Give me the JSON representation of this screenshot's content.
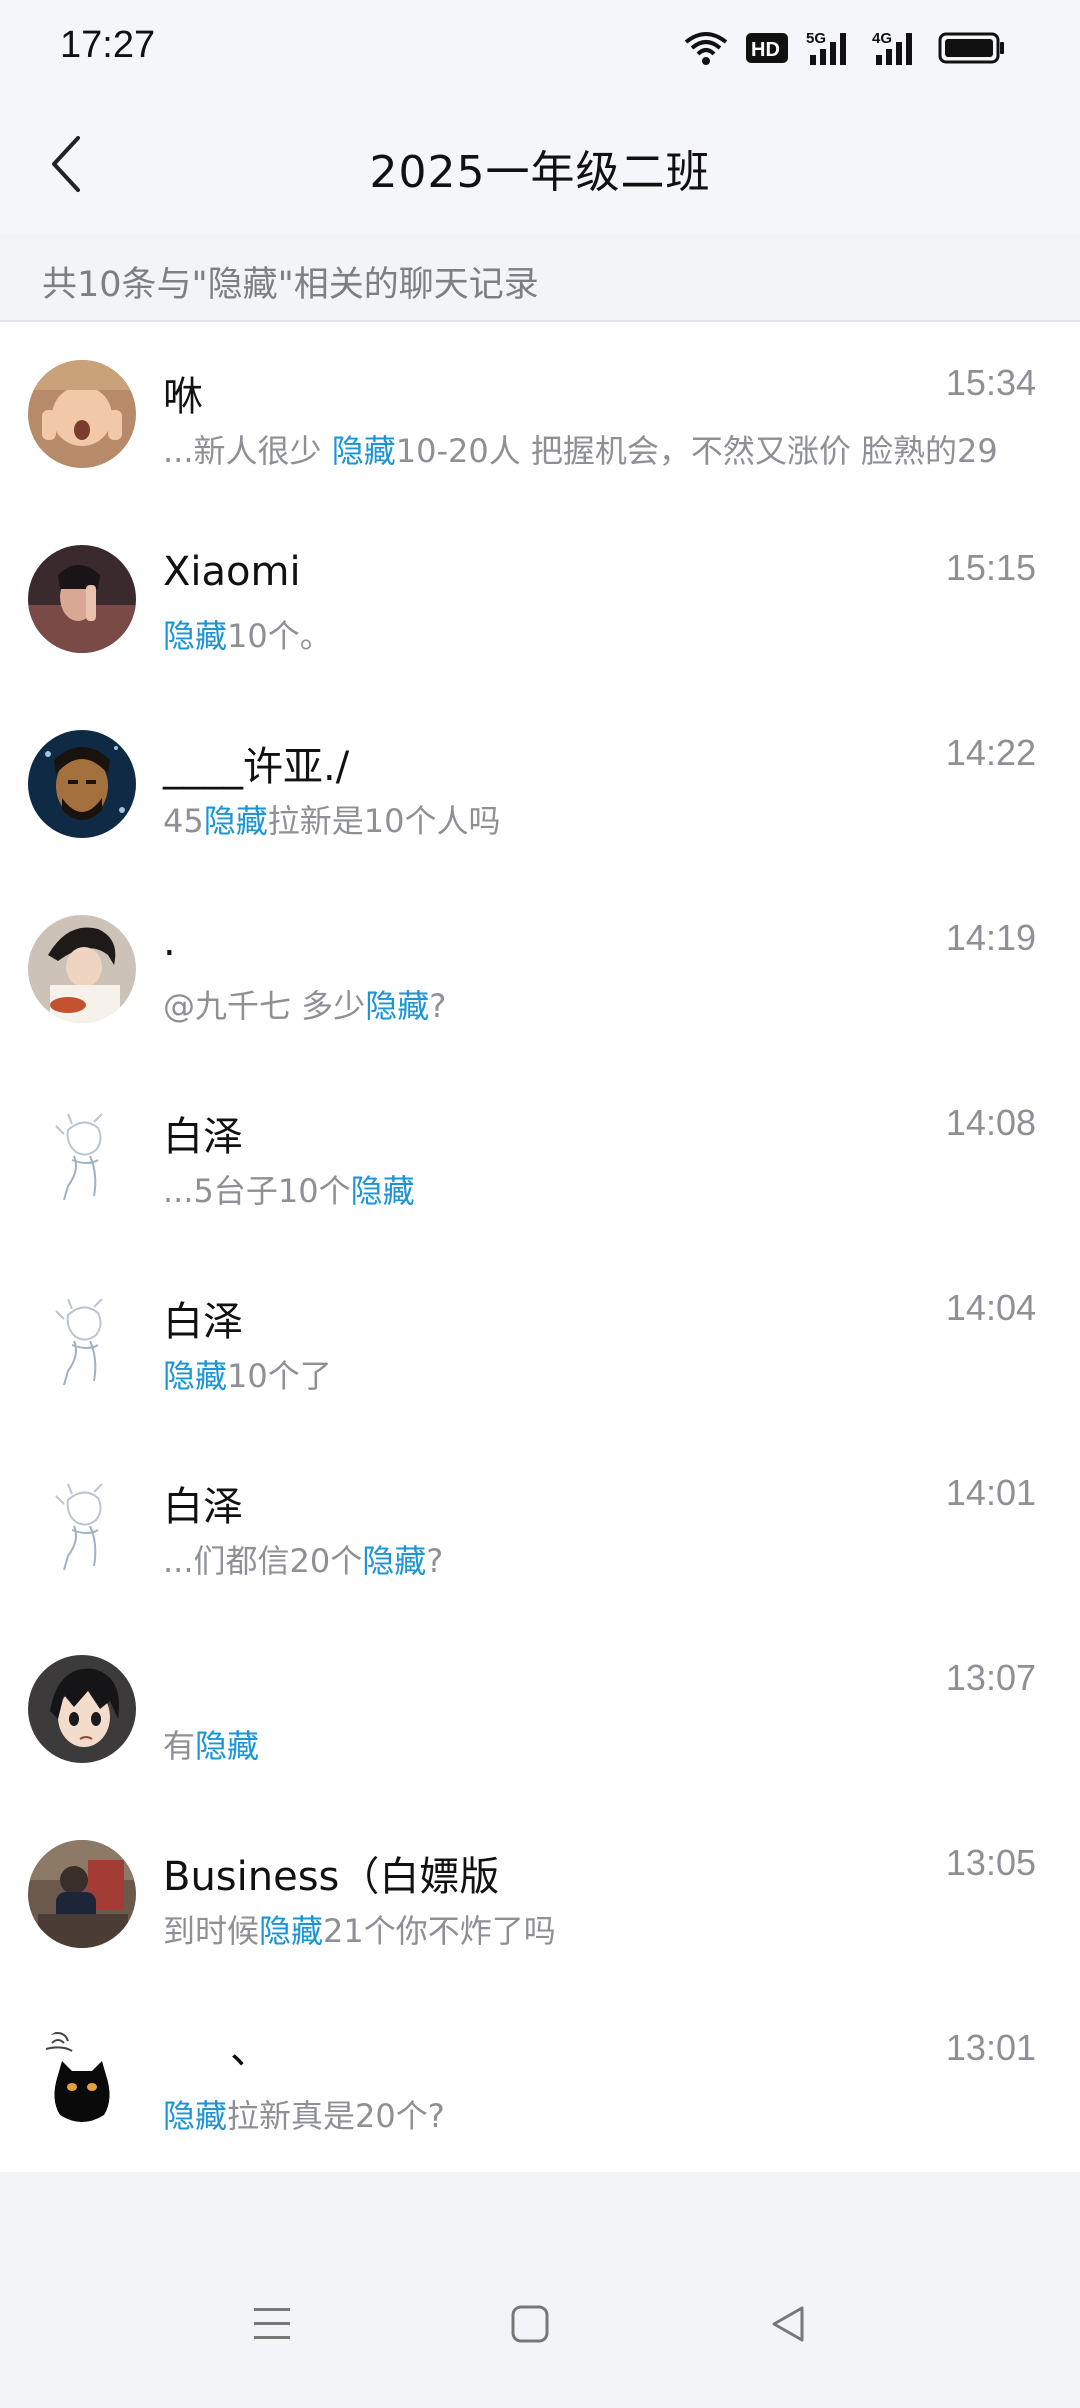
{
  "status": {
    "time": "17:27",
    "icons": [
      "wifi-icon",
      "hd-icon",
      "5g-signal-icon",
      "4g-signal-icon",
      "battery-icon"
    ],
    "hd_label": "HD",
    "net_5g": "5G",
    "net_4g": "4G"
  },
  "header": {
    "title": "2025一年级二班",
    "back_icon": "chevron-left-icon"
  },
  "summary": "共10条与\"隐藏\"相关的聊天记录",
  "colors": {
    "highlight": "#1b95d6",
    "muted": "#8e9096",
    "background": "#f3f4f8"
  },
  "results": [
    {
      "name": "咻",
      "time": "15:34",
      "pre": "...新人很少  ",
      "hl": "隐藏",
      "post": "10-20人   把握机会，不然又涨价  脸熟的29"
    },
    {
      "name": "Xiaomi",
      "time": "15:15",
      "pre": "",
      "hl": "隐藏",
      "post": "10个。"
    },
    {
      "name": "____许亚./",
      "time": "14:22",
      "pre": "45",
      "hl": "隐藏",
      "post": "拉新是10个人吗"
    },
    {
      "name": ".",
      "time": "14:19",
      "pre": "@九千七 多少",
      "hl": "隐藏",
      "post": "?"
    },
    {
      "name": "白泽",
      "time": "14:08",
      "pre": "...5台子10个",
      "hl": "隐藏",
      "post": ""
    },
    {
      "name": "白泽",
      "time": "14:04",
      "pre": "",
      "hl": "隐藏",
      "post": "10个了"
    },
    {
      "name": "白泽",
      "time": "14:01",
      "pre": "...们都信20个",
      "hl": "隐藏",
      "post": "?"
    },
    {
      "name": "",
      "time": "13:07",
      "pre": "有",
      "hl": "隐藏",
      "post": ""
    },
    {
      "name": "Business（白嫖版",
      "time": "13:05",
      "pre": "到时候",
      "hl": "隐藏",
      "post": "21个你不炸了吗"
    },
    {
      "name": "、",
      "time": "13:01",
      "pre": "",
      "hl": "隐藏",
      "post": "拉新真是20个?"
    }
  ],
  "nav": {
    "menu_icon": "menu-icon",
    "home_icon": "home-square-icon",
    "back_icon": "back-triangle-icon"
  }
}
